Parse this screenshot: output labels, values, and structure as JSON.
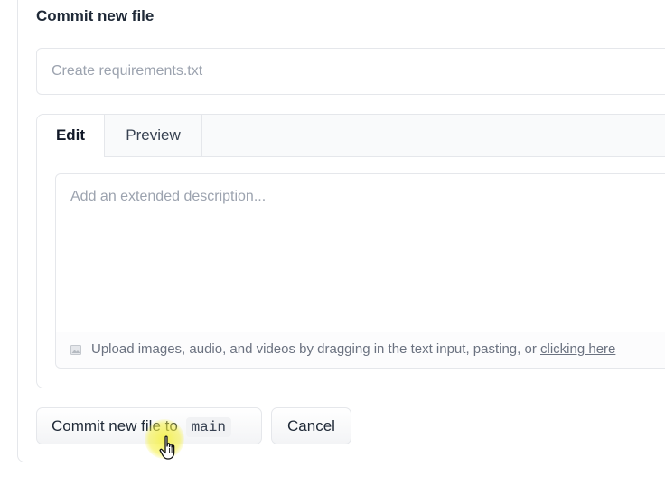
{
  "commit_form": {
    "heading": "Commit new file",
    "summary_placeholder": "Create requirements.txt",
    "tabs": [
      {
        "label": "Edit",
        "active": true
      },
      {
        "label": "Preview",
        "active": false
      }
    ],
    "description_placeholder": "Add an extended description...",
    "upload_hint": "Upload images, audio, and videos by dragging in the text input, pasting, or ",
    "upload_link": "clicking here",
    "commit_button_label": "Commit new file to",
    "branch": "main",
    "cancel_label": "Cancel"
  },
  "icons": {
    "upload": "image-icon",
    "cursor": "hand-pointer-icon"
  },
  "colors": {
    "border": "#e5e7eb",
    "placeholder": "#9ca3af",
    "cursor_highlight": "#f5f03c"
  }
}
